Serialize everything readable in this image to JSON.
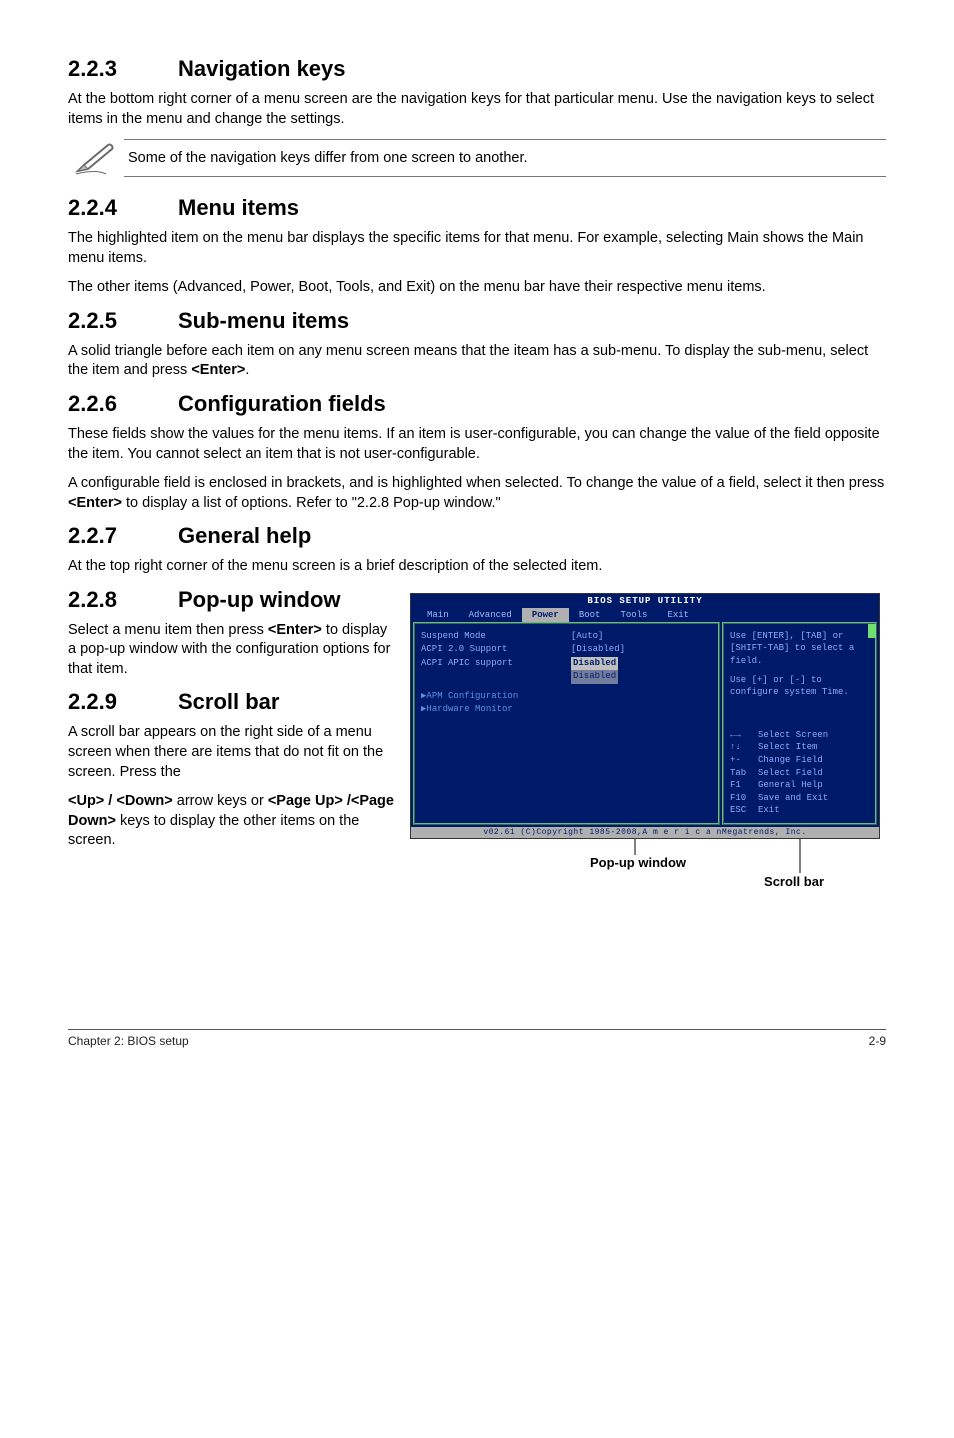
{
  "s223": {
    "num": "2.2.3",
    "title": "Navigation keys",
    "p1": "At the bottom right corner of a menu screen are the navigation keys for that particular menu. Use the navigation keys to select items in the menu and change the settings.",
    "note": "Some of the navigation keys differ from one screen to another."
  },
  "s224": {
    "num": "2.2.4",
    "title": "Menu items",
    "p1": "The highlighted item on the menu bar  displays the specific items for that menu. For example, selecting Main shows the Main menu items.",
    "p2": "The other items (Advanced, Power, Boot, Tools, and Exit) on the menu bar have their respective menu items."
  },
  "s225": {
    "num": "2.2.5",
    "title": "Sub-menu items",
    "p1_a": "A solid triangle before each item on any menu screen means that the iteam has a sub-menu. To display the sub-menu, select the item and press ",
    "p1_b": "<Enter>",
    "p1_c": "."
  },
  "s226": {
    "num": "2.2.6",
    "title": "Configuration fields",
    "p1": "These fields show the values for the menu items. If an item is user-configurable, you can change the value of the field opposite the item. You cannot select an item that is not user-configurable.",
    "p2_a": "A configurable field is enclosed in brackets, and is highlighted when selected. To change the value of a field, select it then press ",
    "p2_b": "<Enter>",
    "p2_c": " to display a list of options. Refer to \"2.2.8 Pop-up window.\""
  },
  "s227": {
    "num": "2.2.7",
    "title": "General help",
    "p1": "At the top right corner of the menu screen is a brief description of the selected item."
  },
  "s228": {
    "num": "2.2.8",
    "title": "Pop-up window",
    "p1_a": "Select a menu item then press ",
    "p1_b": "<Enter>",
    "p1_c": " to display a pop-up window with the configuration options for that item."
  },
  "s229": {
    "num": "2.2.9",
    "title": "Scroll bar",
    "p1": "A scroll bar appears on the right side of a menu screen when there are items that do not fit on the screen. Press the",
    "p2_a": "<Up> / <Down>",
    "p2_b": " arrow keys or ",
    "p2_c": "<Page Up> /<Page Down>",
    "p2_d": " keys to display the other items on the screen."
  },
  "bios": {
    "title": "BIOS SETUP UTILITY",
    "tabs": {
      "main": "Main",
      "adv": "Advanced",
      "power": "Power",
      "boot": "Boot",
      "tools": "Tools",
      "exit": "Exit"
    },
    "left": {
      "r1l": "Suspend Mode",
      "r1v": "[Auto]",
      "r2l": "ACPI 2.0 Support",
      "r2v": "[Disabled]",
      "r3l": "ACPI APIC support",
      "r3v_hi1": "Disabled",
      "r3v_hi2": "Disabled",
      "r4": "APM Configuration",
      "r5": "Hardware Monitor"
    },
    "right": {
      "help1": "Use [ENTER], [TAB] or [SHIFT-TAB] to select a field.",
      "help2": "Use [+] or [-] to configure system Time.",
      "k1k": "←→",
      "k1l": "Select Screen",
      "k2k": "↑↓",
      "k2l": "Select Item",
      "k3k": "+-",
      "k3l": "Change Field",
      "k4k": "Tab",
      "k4l": "Select Field",
      "k5k": "F1",
      "k5l": "General Help",
      "k6k": "F10",
      "k6l": "Save and Exit",
      "k7k": "ESC",
      "k7l": "Exit"
    },
    "foot": "v02.61 (C)Copyright 1985-2008,A m e r i c a nMegatrends, Inc."
  },
  "callouts": {
    "popup": "Pop-up window",
    "scroll": "Scroll bar"
  },
  "footer": {
    "left": "Chapter 2: BIOS setup",
    "right": "2-9"
  }
}
